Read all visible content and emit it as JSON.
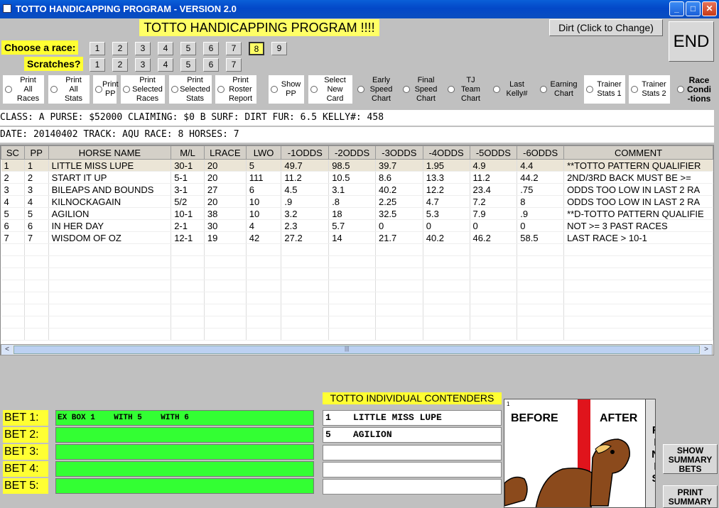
{
  "window": {
    "title": "TOTTO HANDICAPPING PROGRAM - VERSION 2.0",
    "min": "_",
    "max": "□",
    "close": "✕"
  },
  "banner": "TOTTO HANDICAPPING PROGRAM !!!!",
  "dirt_button": "Dirt (Click to Change)",
  "end_button": "END",
  "choose_label": "Choose  a race:",
  "scratches_label": "Scratches?",
  "race_numbers": [
    "1",
    "2",
    "3",
    "4",
    "5",
    "6",
    "7",
    "8",
    "9"
  ],
  "scratch_numbers": [
    "1",
    "2",
    "3",
    "4",
    "5",
    "6",
    "7"
  ],
  "options": [
    "Print\nAll\nRaces",
    "Print\nAll\nStats",
    "Print\nPP",
    "Print\nSelected\nRaces",
    "Print\nSelected\nStats",
    "Print\nRoster\nReport",
    "Show\nPP",
    "Select\nNew\nCard",
    "Early\nSpeed\nChart",
    "Final\nSpeed\nChart",
    "TJ\nTeam\nChart",
    "Last\nKelly#",
    "Earning\nChart",
    "Trainer\nStats 1",
    "Trainer\nStats 2",
    "Race\nCondi\n-tions"
  ],
  "race_info_1": " CLASS: A    PURSE: $52000   CLAIMING: $0 B   SURF: DIRT     FUR: 6.5   KELLY#: 458",
  "race_info_2": "                 DATE: 20140402    TRACK: AQU      RACE: 8    HORSES: 7",
  "table": {
    "headers": [
      "SC",
      "PP",
      "HORSE NAME",
      "M/L",
      "LRACE",
      "LWO",
      "-1ODDS",
      "-2ODDS",
      "-3ODDS",
      "-4ODDS",
      "-5ODDS",
      "-6ODDS",
      "COMMENT"
    ],
    "rows": [
      [
        "1",
        "1",
        "LITTLE MISS LUPE",
        "30-1",
        "20",
        "5",
        "49.7",
        "98.5",
        "39.7",
        "1.95",
        "4.9",
        "4.4",
        "**TOTTO PATTERN QUALIFIER"
      ],
      [
        "2",
        "2",
        "START IT UP",
        "5-1",
        "20",
        "111",
        "11.2",
        "10.5",
        "8.6",
        "13.3",
        "11.2",
        "44.2",
        "   2ND/3RD BACK MUST BE >="
      ],
      [
        "3",
        "3",
        "BILEAPS AND BOUNDS",
        "3-1",
        "27",
        "6",
        "4.5",
        "3.1",
        "40.2",
        "12.2",
        "23.4",
        ".75",
        "ODDS TOO LOW IN LAST 2 RA"
      ],
      [
        "4",
        "4",
        "KILNOCKAGAIN",
        "5/2",
        "20",
        "10",
        ".9",
        ".8",
        "2.25",
        "4.7",
        "7.2",
        "8",
        "ODDS TOO LOW IN LAST 2 RA"
      ],
      [
        "5",
        "5",
        "AGILION",
        "10-1",
        "38",
        "10",
        "3.2",
        "18",
        "32.5",
        "5.3",
        "7.9",
        ".9",
        "**D-TOTTO PATTERN QUALIFIE"
      ],
      [
        "6",
        "6",
        "IN HER DAY",
        "2-1",
        "30",
        "4",
        "2.3",
        "5.7",
        "0",
        "0",
        "0",
        "0",
        "NOT >= 3 PAST RACES"
      ],
      [
        "7",
        "7",
        "WISDOM OF OZ",
        "12-1",
        "19",
        "42",
        "27.2",
        "14",
        "21.7",
        "40.2",
        "46.2",
        "58.5",
        "      LAST RACE > 10-1"
      ]
    ]
  },
  "scroll": {
    "left": "<",
    "right": ">",
    "grip": "|||"
  },
  "bets": {
    "labels": [
      "BET 1:",
      "BET 2:",
      "BET 3:",
      "BET 4:",
      "BET 5:"
    ],
    "values": [
      "EX BOX 1    WITH 5    WITH 6",
      "",
      "",
      "",
      ""
    ]
  },
  "contenders": {
    "title": "TOTTO INDIVIDUAL CONTENDERS",
    "items": [
      "1    LITTLE MISS LUPE",
      "5    AGILION",
      "",
      "",
      ""
    ]
  },
  "finish_image": {
    "before": "BEFORE",
    "after": "AFTER",
    "finis": "FINIS",
    "corner": "1"
  },
  "show_summary": "SHOW SUMMARY BETS",
  "print_summary": "PRINT SUMMARY"
}
